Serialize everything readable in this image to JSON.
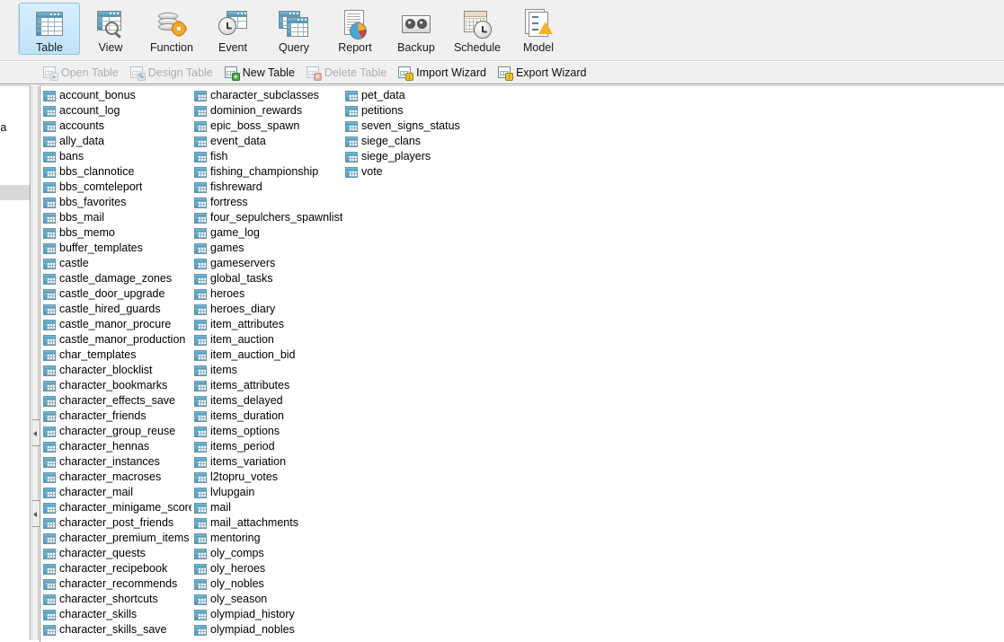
{
  "main_toolbar": {
    "buttons": [
      {
        "label": "Table",
        "icon": "table-icon",
        "selected": true
      },
      {
        "label": "View",
        "icon": "view-icon",
        "selected": false
      },
      {
        "label": "Function",
        "icon": "function-icon",
        "selected": false
      },
      {
        "label": "Event",
        "icon": "event-icon",
        "selected": false
      },
      {
        "label": "Query",
        "icon": "query-icon",
        "selected": false
      },
      {
        "label": "Report",
        "icon": "report-icon",
        "selected": false
      },
      {
        "label": "Backup",
        "icon": "backup-icon",
        "selected": false
      },
      {
        "label": "Schedule",
        "icon": "schedule-icon",
        "selected": false
      },
      {
        "label": "Model",
        "icon": "model-icon",
        "selected": false
      }
    ],
    "selected_tab": "Table",
    "highlight_color": "#bfe3fa",
    "background_color": "#f0f0f0"
  },
  "sub_toolbar": {
    "buttons": [
      {
        "label": "Open Table",
        "icon": "open-table-icon",
        "enabled": false
      },
      {
        "label": "Design Table",
        "icon": "design-table-icon",
        "enabled": false
      },
      {
        "label": "New Table",
        "icon": "new-table-icon",
        "enabled": true
      },
      {
        "label": "Delete Table",
        "icon": "delete-table-icon",
        "enabled": false
      },
      {
        "label": "Import Wizard",
        "icon": "import-wizard-icon",
        "enabled": true
      },
      {
        "label": "Export Wizard",
        "icon": "export-wizard-icon",
        "enabled": true
      }
    ],
    "disabled_text_color": "#aeaeae"
  },
  "left_nav": {
    "visible_label": "ma",
    "selected_row_color": "#d8d8d8"
  },
  "splitter": {
    "collapse_arrow_icon": "chevron-left-icon"
  },
  "table_list": {
    "item_icon": "table-icon",
    "items": [
      "account_bonus",
      "account_log",
      "accounts",
      "ally_data",
      "bans",
      "bbs_clannotice",
      "bbs_comteleport",
      "bbs_favorites",
      "bbs_mail",
      "bbs_memo",
      "buffer_templates",
      "castle",
      "castle_damage_zones",
      "castle_door_upgrade",
      "castle_hired_guards",
      "castle_manor_procure",
      "castle_manor_production",
      "char_templates",
      "character_blocklist",
      "character_bookmarks",
      "character_effects_save",
      "character_friends",
      "character_group_reuse",
      "character_hennas",
      "character_instances",
      "character_macroses",
      "character_mail",
      "character_minigame_score",
      "character_post_friends",
      "character_premium_items",
      "character_quests",
      "character_recipebook",
      "character_recommends",
      "character_shortcuts",
      "character_skills",
      "character_skills_save",
      "character_subclasses",
      "dominion_rewards",
      "epic_boss_spawn",
      "event_data",
      "fish",
      "fishing_championship",
      "fishreward",
      "fortress",
      "four_sepulchers_spawnlist",
      "game_log",
      "games",
      "gameservers",
      "global_tasks",
      "heroes",
      "heroes_diary",
      "item_attributes",
      "item_auction",
      "item_auction_bid",
      "items",
      "items_attributes",
      "items_delayed",
      "items_duration",
      "items_options",
      "items_period",
      "items_variation",
      "l2topru_votes",
      "lvlupgain",
      "mail",
      "mail_attachments",
      "mentoring",
      "oly_comps",
      "oly_heroes",
      "oly_nobles",
      "oly_season",
      "olympiad_history",
      "olympiad_nobles",
      "pet_data",
      "petitions",
      "seven_signs_status",
      "siege_clans",
      "siege_players",
      "vote"
    ]
  }
}
